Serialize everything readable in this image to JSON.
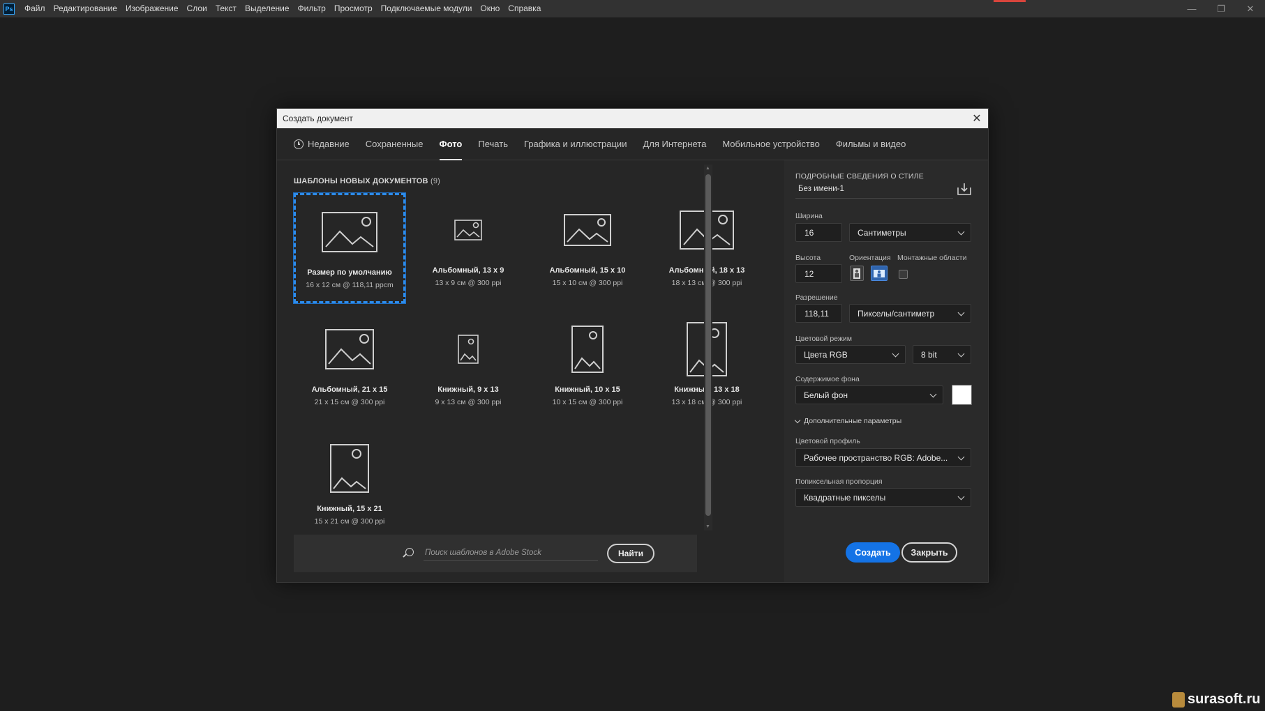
{
  "menubar": {
    "app_logo": "Ps",
    "items": [
      "Файл",
      "Редактирование",
      "Изображение",
      "Слои",
      "Текст",
      "Выделение",
      "Фильтр",
      "Просмотр",
      "Подключаемые модули",
      "Окно",
      "Справка"
    ]
  },
  "dialog": {
    "title": "Создать документ",
    "tabs": [
      "Недавние",
      "Сохраненные",
      "Фото",
      "Печать",
      "Графика и иллюстрации",
      "Для Интернета",
      "Мобильное устройство",
      "Фильмы и видео"
    ],
    "active_tab": "Фото",
    "templates_heading": "ШАБЛОНЫ НОВЫХ ДОКУМЕНТОВ",
    "templates_count": "(9)",
    "templates": [
      {
        "name": "Размер по умолчанию",
        "dims": "16 x 12 см @ 118,11 ppcm",
        "selected": true
      },
      {
        "name": "Альбомный, 13 x 9",
        "dims": "13 x 9 см @ 300 ppi"
      },
      {
        "name": "Альбомный, 15 x 10",
        "dims": "15 x 10 см @ 300 ppi"
      },
      {
        "name": "Альбомный, 18 x 13",
        "dims": "18 x 13 см @ 300 ppi"
      },
      {
        "name": "Альбомный, 21 x 15",
        "dims": "21 x 15 см @ 300 ppi"
      },
      {
        "name": "Книжный, 9 x 13",
        "dims": "9 x 13 см @ 300 ppi"
      },
      {
        "name": "Книжный, 10 x 15",
        "dims": "10 x 15 см @ 300 ppi"
      },
      {
        "name": "Книжный, 13 x 18",
        "dims": "13 x 18 см @ 300 ppi"
      },
      {
        "name": "Книжный, 15 x 21",
        "dims": "15 x 21 см @ 300 ppi"
      }
    ],
    "search": {
      "placeholder": "Поиск шаблонов в Adobe Stock",
      "button": "Найти"
    },
    "details": {
      "heading": "ПОДРОБНЫЕ СВЕДЕНИЯ О СТИЛЕ",
      "doc_name": "Без имени-1",
      "width_label": "Ширина",
      "width_value": "16",
      "width_unit": "Сантиметры",
      "height_label": "Высота",
      "height_value": "12",
      "orientation_label": "Ориентация",
      "artboards_label": "Монтажные области",
      "resolution_label": "Разрешение",
      "resolution_value": "118,11",
      "resolution_unit": "Пикселы/сантиметр",
      "color_mode_label": "Цветовой режим",
      "color_mode_value": "Цвета RGB",
      "bit_depth": "8 bit",
      "bg_label": "Содержимое фона",
      "bg_value": "Белый фон",
      "bg_color": "#ffffff",
      "advanced_label": "Дополнительные параметры",
      "profile_label": "Цветовой профиль",
      "profile_value": "Рабочее пространство RGB: Adobe...",
      "pixel_ratio_label": "Попиксельная пропорция",
      "pixel_ratio_value": "Квадратные пикселы",
      "create_button": "Создать",
      "close_button": "Закрыть"
    }
  },
  "accent_color": "#1473e6",
  "watermark": "surasoft.ru"
}
